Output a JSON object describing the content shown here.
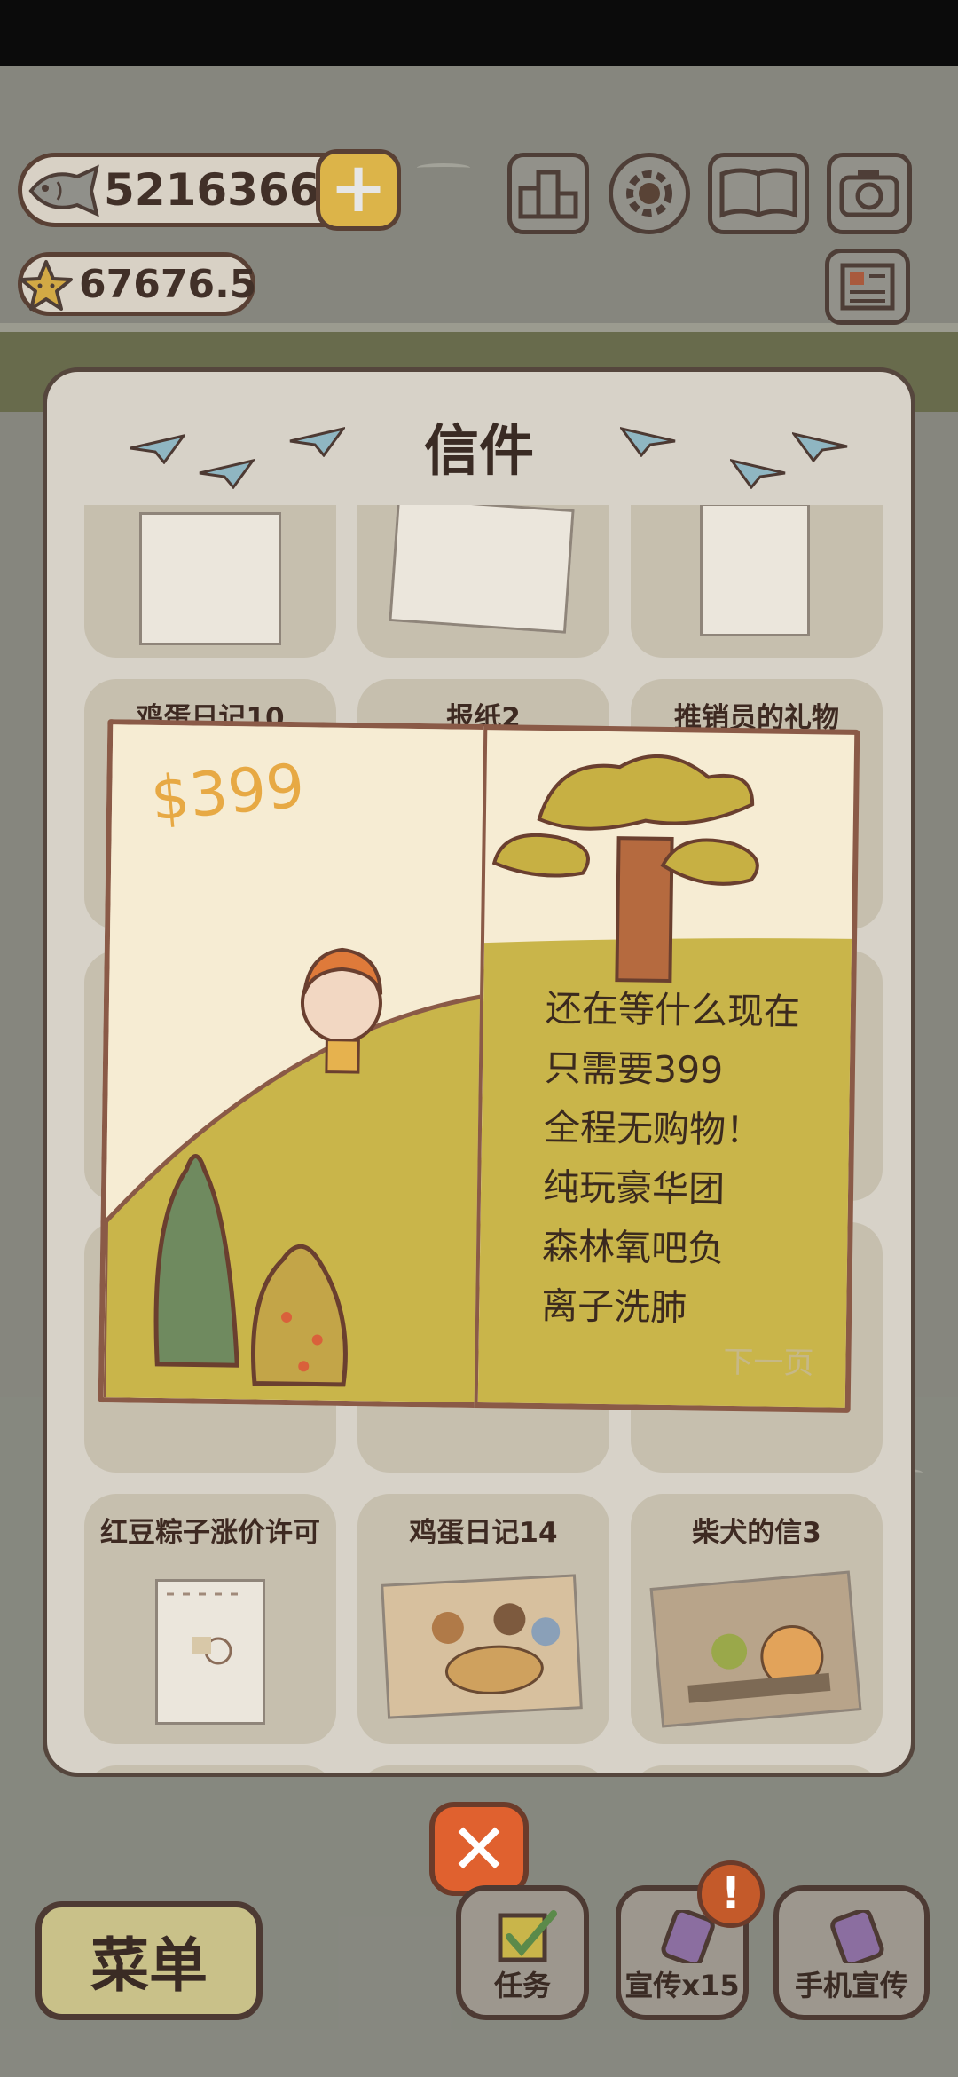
{
  "hud": {
    "fish_count": "5216366",
    "star_count": "67676.5",
    "top_icons": [
      "ranking-icon",
      "settings-gear-icon",
      "album-icon",
      "camera-icon",
      "newspaper-icon"
    ]
  },
  "panel": {
    "title": "信件",
    "cards": [
      {
        "title": ""
      },
      {
        "title": ""
      },
      {
        "title": ""
      },
      {
        "title": "鸡蛋日记10"
      },
      {
        "title": "报纸2"
      },
      {
        "title": "推销员的礼物"
      },
      {
        "title": "红豆粽子涨价许可"
      },
      {
        "title": "鸡蛋日记14"
      },
      {
        "title": "柴犬的信3"
      }
    ]
  },
  "letter": {
    "price": "$399",
    "lines": [
      "还在等什么现在",
      "只需要399",
      "全程无购物！",
      "纯玩豪华团",
      "森林氧吧负",
      "离子洗肺"
    ],
    "next_page": "下一页"
  },
  "bottom": {
    "menu_label": "菜单",
    "task_label": "任务",
    "promo_label": "宣传x15",
    "phone_promo_label": "手机宣传",
    "badge": "!"
  },
  "colors": {
    "accent_yellow": "#f4c548",
    "close_red": "#e0612f",
    "price_orange": "#e7a944",
    "hill_green": "#c9b54a",
    "tree_green": "#6f8a5f"
  }
}
